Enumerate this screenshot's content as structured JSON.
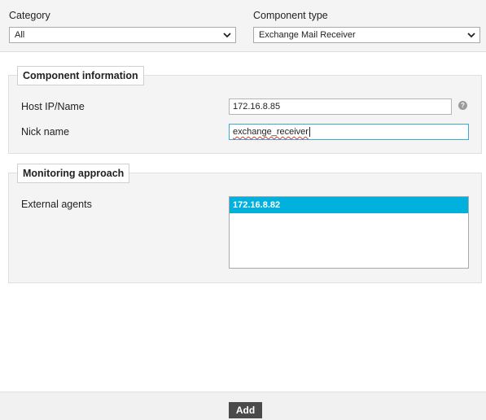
{
  "header": {
    "category": {
      "label": "Category",
      "value": "All"
    },
    "component_type": {
      "label": "Component type",
      "value": "Exchange Mail Receiver"
    }
  },
  "component_information": {
    "legend": "Component information",
    "host": {
      "label": "Host IP/Name",
      "value": "172.16.8.85"
    },
    "nick": {
      "label": "Nick name",
      "value": "exchange_receiver"
    },
    "help_icon": "question-circle-icon"
  },
  "monitoring_approach": {
    "legend": "Monitoring approach",
    "external_agents": {
      "label": "External agents",
      "items": [
        "172.16.8.82"
      ]
    }
  },
  "footer": {
    "add_label": "Add"
  },
  "colors": {
    "selected_item": "#00b0dd",
    "focus_border": "#39a9d8",
    "button_bg": "#4a4a4a"
  }
}
